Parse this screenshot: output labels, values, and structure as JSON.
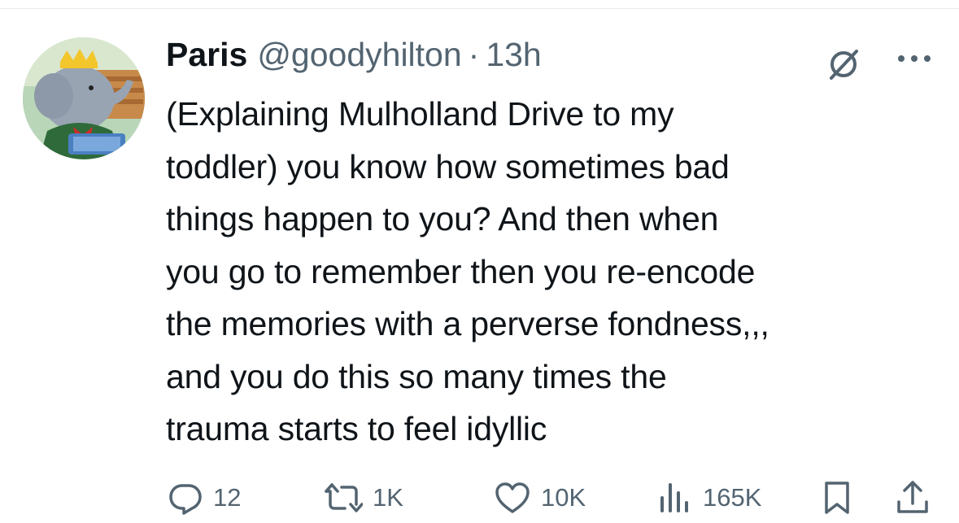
{
  "tweet": {
    "author_name": "Paris",
    "handle": "@goodyhilton",
    "separator": "·",
    "time": "13h",
    "text": "(Explaining Mulholland Drive to my\ntoddler) you know how sometimes bad\nthings happen to you? And then when\nyou go to remember then you re-encode\nthe memories with a perverse fondness,,,\nand you do this so many times the\ntrauma starts to feel idyllic"
  },
  "actions": {
    "replies": "12",
    "reposts": "1K",
    "likes": "10K",
    "views": "165K"
  },
  "icons": {
    "grok": "grok-icon",
    "more": "more-icon",
    "reply": "reply-icon",
    "repost": "repost-icon",
    "like": "heart-icon",
    "views": "views-icon",
    "bookmark": "bookmark-icon",
    "share": "share-icon"
  },
  "colors": {
    "text": "#0f1419",
    "secondary": "#536471",
    "divider": "#e6e9eb"
  }
}
